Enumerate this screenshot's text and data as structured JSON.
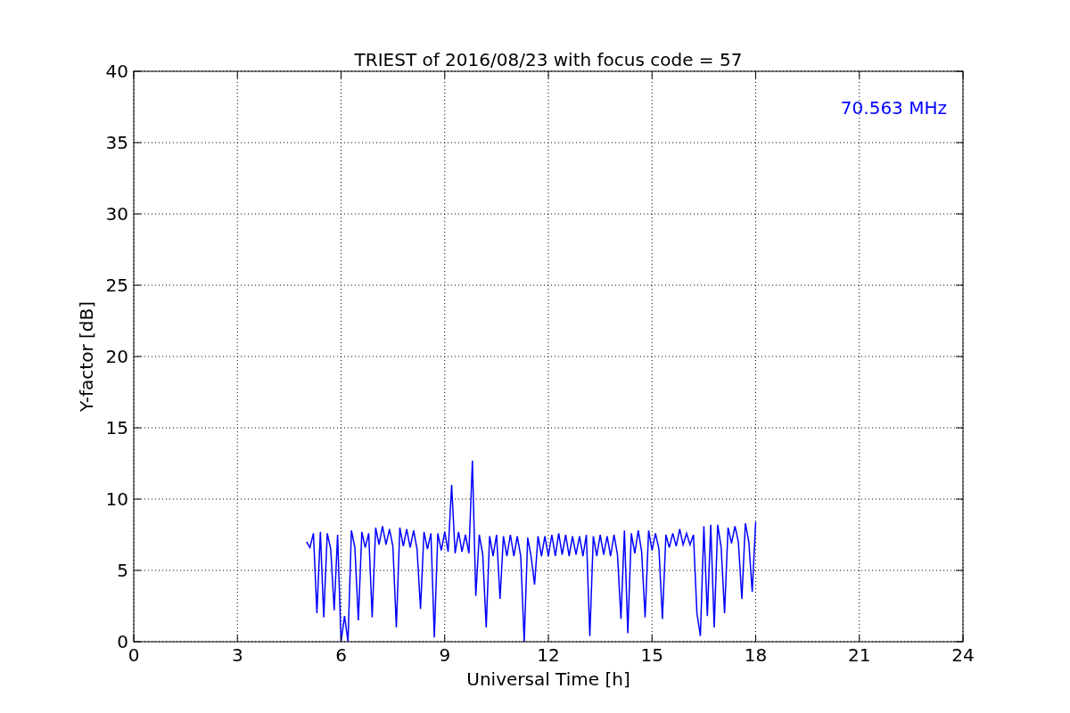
{
  "figure": {
    "chart_data": {
      "type": "line",
      "title": "TRIEST of 2016/08/23 with focus code = 57",
      "xlabel": "Universal Time [h]",
      "ylabel": "Y-factor [dB]",
      "grid": true,
      "xlim": [
        0,
        24
      ],
      "ylim": [
        0,
        40
      ],
      "xticks": [
        0,
        3,
        6,
        9,
        12,
        15,
        18,
        21,
        24
      ],
      "yticks": [
        0,
        5,
        10,
        15,
        20,
        25,
        30,
        35,
        40
      ],
      "x": [
        5.0,
        5.1,
        5.2,
        5.3,
        5.4,
        5.5,
        5.6,
        5.7,
        5.8,
        5.9,
        6.0,
        6.1,
        6.2,
        6.3,
        6.4,
        6.5,
        6.6,
        6.7,
        6.8,
        6.9,
        7.0,
        7.1,
        7.2,
        7.3,
        7.4,
        7.5,
        7.6,
        7.7,
        7.8,
        7.9,
        8.0,
        8.1,
        8.2,
        8.3,
        8.4,
        8.5,
        8.6,
        8.7,
        8.8,
        8.9,
        9.0,
        9.1,
        9.2,
        9.3,
        9.4,
        9.5,
        9.6,
        9.7,
        9.8,
        9.9,
        10.0,
        10.1,
        10.2,
        10.3,
        10.4,
        10.5,
        10.6,
        10.7,
        10.8,
        10.9,
        11.0,
        11.1,
        11.2,
        11.3,
        11.4,
        11.5,
        11.6,
        11.7,
        11.8,
        11.9,
        12.0,
        12.1,
        12.2,
        12.3,
        12.4,
        12.5,
        12.6,
        12.7,
        12.8,
        12.9,
        13.0,
        13.1,
        13.2,
        13.3,
        13.4,
        13.5,
        13.6,
        13.7,
        13.8,
        13.9,
        14.0,
        14.1,
        14.2,
        14.3,
        14.4,
        14.5,
        14.6,
        14.7,
        14.8,
        14.9,
        15.0,
        15.1,
        15.2,
        15.3,
        15.4,
        15.5,
        15.6,
        15.7,
        15.8,
        15.9,
        16.0,
        16.1,
        16.2,
        16.3,
        16.4,
        16.5,
        16.6,
        16.7,
        16.8,
        16.9,
        17.0,
        17.1,
        17.2,
        17.3,
        17.4,
        17.5,
        17.6,
        17.7,
        17.8,
        17.9,
        18.0
      ],
      "series": [
        {
          "name": "70.563 MHz",
          "color": "#0000ff",
          "values": [
            7.0,
            6.6,
            7.6,
            2.0,
            7.7,
            1.7,
            7.6,
            6.5,
            2.2,
            7.5,
            0,
            1.8,
            0,
            7.8,
            6.6,
            1.5,
            7.7,
            6.6,
            7.6,
            1.7,
            8.0,
            6.8,
            8.1,
            6.8,
            7.9,
            6.7,
            1.0,
            8.0,
            6.7,
            7.9,
            6.6,
            7.8,
            6.5,
            2.3,
            7.7,
            6.5,
            7.6,
            0.3,
            7.6,
            6.4,
            7.7,
            6.3,
            11.0,
            6.2,
            7.7,
            6.3,
            7.5,
            6.2,
            12.7,
            3.2,
            7.5,
            6.1,
            1.0,
            7.4,
            6.0,
            7.5,
            3.0,
            7.4,
            6.0,
            7.5,
            6.0,
            7.4,
            6.0,
            0,
            7.3,
            6.0,
            4.0,
            7.4,
            6.0,
            7.4,
            6.0,
            7.5,
            6.0,
            7.6,
            6.1,
            7.5,
            6.0,
            7.4,
            6.1,
            7.4,
            6.0,
            7.5,
            0.4,
            7.4,
            6.0,
            7.5,
            6.1,
            7.4,
            6.0,
            7.5,
            6.1,
            1.6,
            7.8,
            0.6,
            7.6,
            6.2,
            7.8,
            6.3,
            1.7,
            7.8,
            6.4,
            7.6,
            6.5,
            1.6,
            7.5,
            6.6,
            7.6,
            6.7,
            7.9,
            6.8,
            7.6,
            6.8,
            7.5,
            2.0,
            0.4,
            8.1,
            1.8,
            8.2,
            1.0,
            8.2,
            6.6,
            2.0,
            8.0,
            6.9,
            8.1,
            7.0,
            3.0,
            8.3,
            7.0,
            3.5,
            8.4
          ]
        }
      ]
    }
  }
}
